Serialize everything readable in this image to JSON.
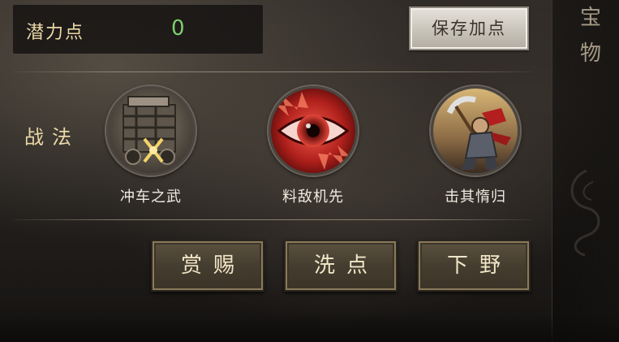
{
  "potential": {
    "label": "潜力点",
    "value": "0"
  },
  "save_button": {
    "label": "保存加点"
  },
  "tactics": {
    "label": "战法",
    "skills": [
      {
        "name": "冲车之武",
        "icon": "siege-cart-icon"
      },
      {
        "name": "料敌机先",
        "icon": "red-eye-icon"
      },
      {
        "name": "击其惰归",
        "icon": "warrior-axe-icon"
      }
    ]
  },
  "actions": [
    {
      "label": "赏赐"
    },
    {
      "label": "洗点"
    },
    {
      "label": "下野"
    }
  ],
  "side_tab": {
    "label": "宝物"
  },
  "colors": {
    "label_gold": "#e9d8a6",
    "value_green": "#7ccf6e",
    "button_bronze": "#453d2f"
  }
}
